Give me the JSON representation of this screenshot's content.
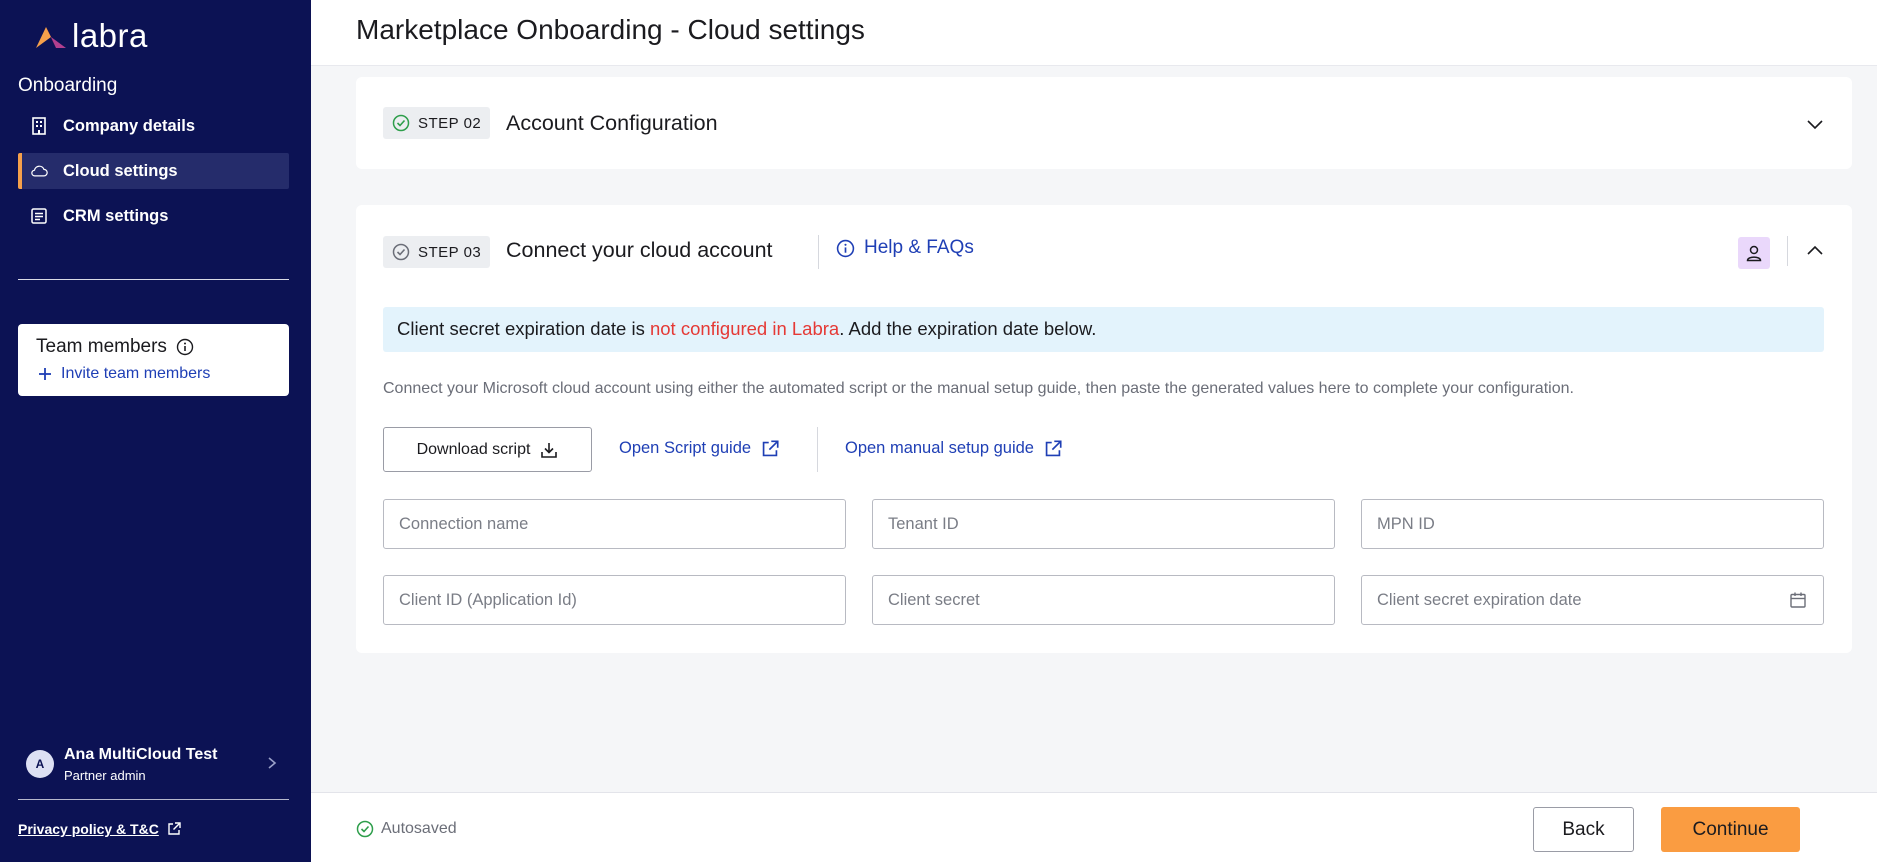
{
  "brand": {
    "name": "labra",
    "accent": "#f5a04b"
  },
  "sidebar": {
    "section_title": "Onboarding",
    "items": [
      {
        "label": "Company details",
        "icon": "building-icon",
        "active": false
      },
      {
        "label": "Cloud settings",
        "icon": "cloud-icon",
        "active": true
      },
      {
        "label": "CRM settings",
        "icon": "list-icon",
        "active": false
      }
    ],
    "team": {
      "title": "Team members",
      "invite_label": "Invite team members"
    },
    "user": {
      "initial": "A",
      "name": "Ana MultiCloud Test",
      "role": "Partner admin"
    },
    "privacy_label": "Privacy policy & T&C"
  },
  "header": {
    "title": "Marketplace Onboarding - Cloud settings"
  },
  "step2": {
    "badge": "STEP 02",
    "title": "Account Configuration",
    "status": "completed"
  },
  "step3": {
    "badge": "STEP 03",
    "title": "Connect your cloud account",
    "help_label": "Help & FAQs",
    "alert": {
      "prefix": "Client secret expiration date is ",
      "highlight": "not configured in Labra",
      "suffix": ". Add the expiration date below."
    },
    "description": "Connect your Microsoft cloud account using either the automated script or the manual setup guide, then paste the generated values here to complete your configuration.",
    "download_label": "Download script",
    "script_guide_label": "Open Script guide",
    "manual_guide_label": "Open manual setup guide",
    "fields": {
      "connection_name": {
        "placeholder": "Connection name",
        "value": ""
      },
      "tenant_id": {
        "placeholder": "Tenant ID",
        "value": ""
      },
      "mpn_id": {
        "placeholder": "MPN ID",
        "value": ""
      },
      "client_id": {
        "placeholder": "Client ID (Application Id)",
        "value": ""
      },
      "client_secret": {
        "placeholder": "Client secret",
        "value": ""
      },
      "expiration_date": {
        "placeholder": "Client secret expiration date",
        "value": ""
      }
    }
  },
  "footer": {
    "autosaved": "Autosaved",
    "back_label": "Back",
    "continue_label": "Continue"
  },
  "colors": {
    "sidebar_bg": "#0c1254",
    "link": "#1f3fb5",
    "warning": "#e53935",
    "continue": "#fa9c41",
    "success": "#2e9e4b"
  }
}
